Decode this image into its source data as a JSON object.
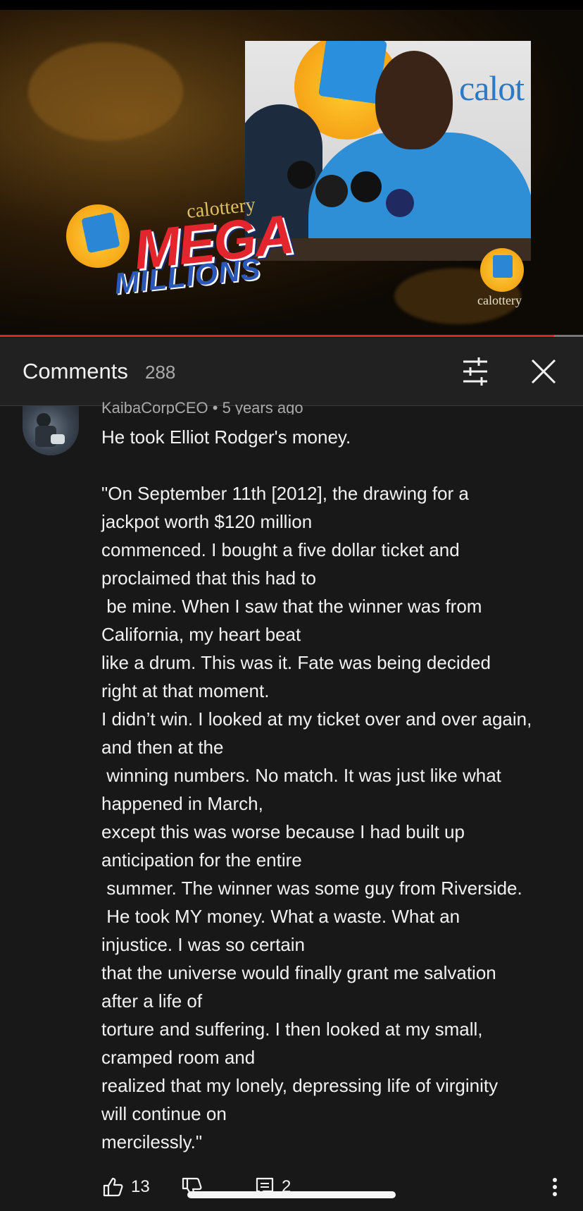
{
  "video": {
    "logo_calottery": "calottery",
    "logo_mega": "MEGA",
    "logo_millions": "MILLIONS",
    "photo_brand": "calot",
    "corner_brand": "calottery",
    "progress_fraction": 0.95,
    "accent_color": "#e1261c"
  },
  "header": {
    "title": "Comments",
    "count": "288",
    "filter_icon": "sliders-icon",
    "close_icon": "close-icon"
  },
  "comment": {
    "author": "KaibaCorpCEO",
    "separator": "•",
    "age": "5 years ago",
    "lines": [
      "He took Elliot Rodger's money.",
      "",
      "\"On September 11th [2012], the drawing for a",
      "jackpot worth $120 million",
      "commenced. I bought a five dollar ticket and",
      "proclaimed that this had to",
      " be mine. When I saw that the winner was from",
      "California, my heart beat",
      "like a drum. This was it. Fate was being decided",
      "right at that moment.",
      "I didn’t win. I looked at my ticket over and over again,",
      "and then at the",
      " winning numbers. No match. It was just like what",
      "happened in March,",
      "except this was worse because I had built up",
      "anticipation for the entire",
      " summer. The winner was some guy from Riverside.",
      " He took MY money. What a waste. What an",
      "injustice. I was so certain",
      "that the universe would finally grant me salvation",
      "after a life of",
      "torture and suffering. I then looked at my small,",
      "cramped room and",
      "realized that my lonely, depressing life of virginity",
      "will continue on",
      "mercilessly.\""
    ],
    "likes": "13",
    "replies": "2"
  }
}
